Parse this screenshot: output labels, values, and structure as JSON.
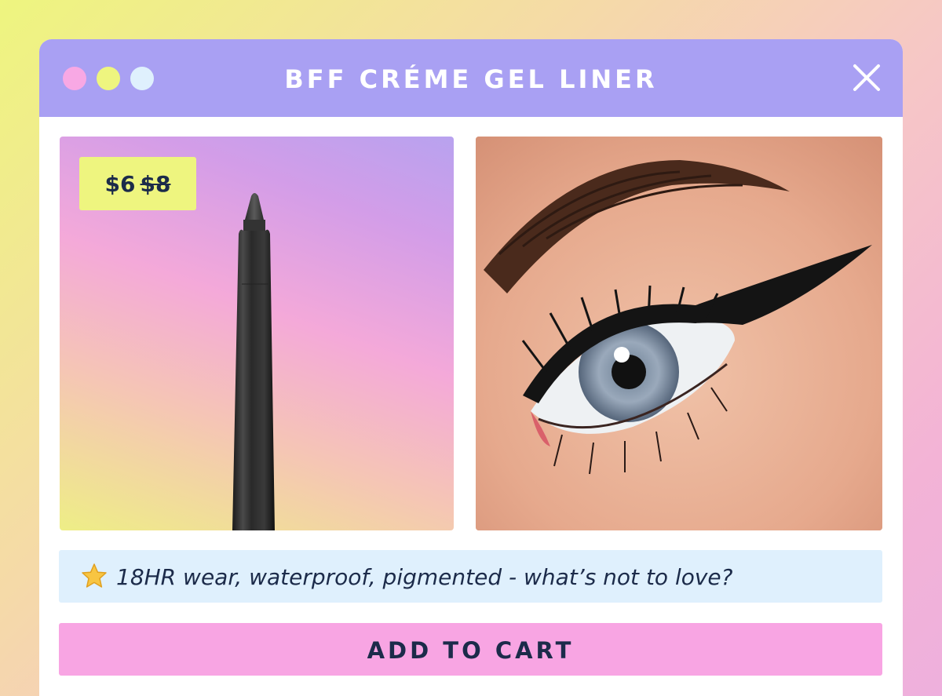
{
  "window": {
    "title": "BFF CRÉME GEL LINER",
    "dots": [
      "pink",
      "yellow",
      "light-blue"
    ]
  },
  "product": {
    "price_current": "$6",
    "price_original": "$8",
    "product_image_icon": "eyeliner-pencil",
    "model_image_icon": "eye-with-winged-liner"
  },
  "feature": {
    "icon": "star-icon",
    "text": "18HR wear, waterproof, pigmented - what’s not to love?"
  },
  "cta": {
    "label": "ADD TO CART"
  },
  "colors": {
    "titlebar": "#a9a0f3",
    "badge": "#eef57f",
    "feature_bg": "#dff0fd",
    "cta_bg": "#f8a5e3",
    "text_dark": "#1c2b4a"
  }
}
